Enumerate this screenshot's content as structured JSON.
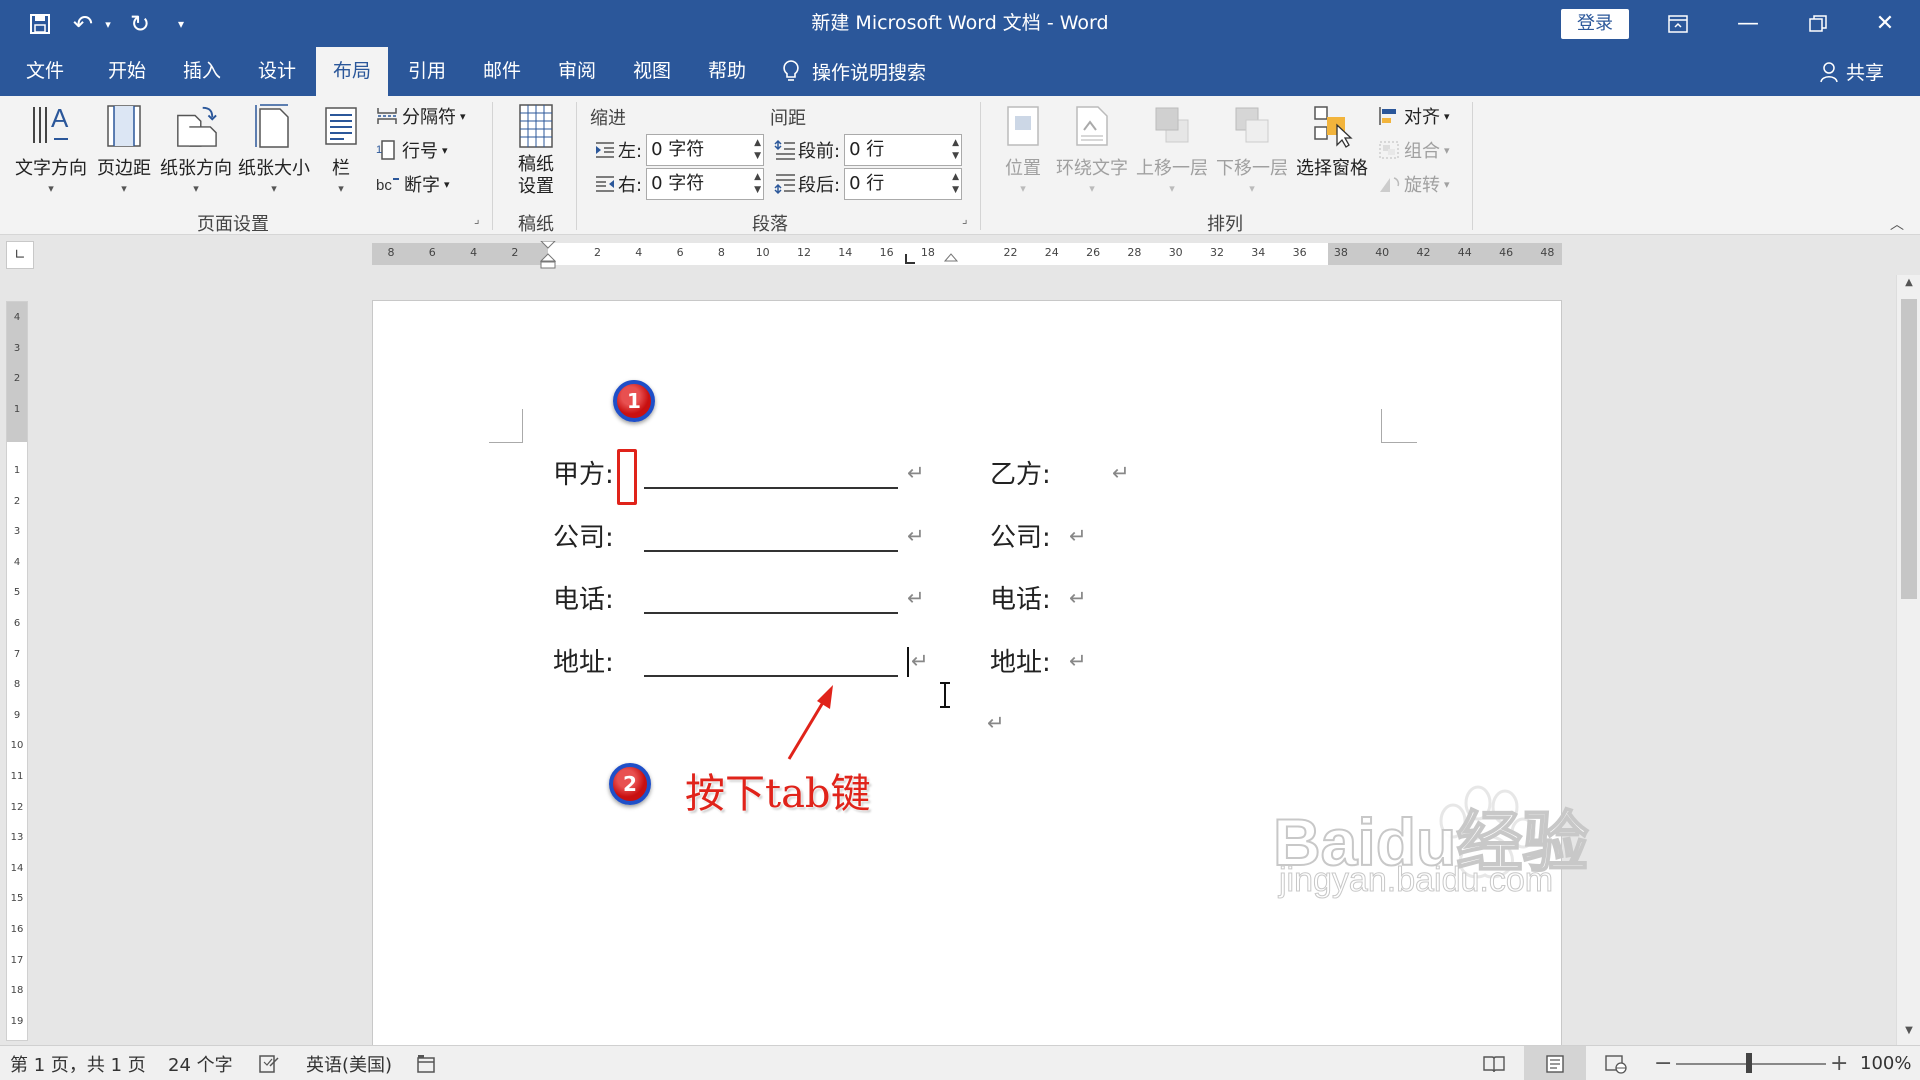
{
  "window": {
    "title": "新建 Microsoft Word 文档 - Word",
    "login_label": "登录"
  },
  "menu": {
    "tabs": [
      {
        "label": "文件"
      },
      {
        "label": "开始"
      },
      {
        "label": "插入"
      },
      {
        "label": "设计"
      },
      {
        "label": "布局"
      },
      {
        "label": "引用"
      },
      {
        "label": "邮件"
      },
      {
        "label": "审阅"
      },
      {
        "label": "视图"
      },
      {
        "label": "帮助"
      }
    ],
    "active_tab": "布局",
    "search_label": "操作说明搜索",
    "share_label": "共享"
  },
  "ribbon": {
    "page_setup": {
      "label": "页面设置",
      "text_direction": "文字方向",
      "margins": "页边距",
      "orientation": "纸张方向",
      "size": "纸张大小",
      "columns": "栏",
      "breaks": "分隔符",
      "line_numbers": "行号",
      "hyphenation": "断字"
    },
    "manuscript": {
      "label": "稿纸",
      "button": "稿纸\n设置"
    },
    "paragraph": {
      "label": "段落",
      "indent_title": "缩进",
      "spacing_title": "间距",
      "left_label": "左:",
      "left_value": "0 字符",
      "right_label": "右:",
      "right_value": "0 字符",
      "before_label": "段前:",
      "before_value": "0 行",
      "after_label": "段后:",
      "after_value": "0 行"
    },
    "arrange": {
      "label": "排列",
      "position": "位置",
      "wrap_text": "环绕文字",
      "bring_forward": "上移一层",
      "send_backward": "下移一层",
      "selection_pane": "选择窗格",
      "align": "对齐",
      "group": "组合",
      "rotate": "旋转"
    }
  },
  "ruler": {
    "labels": [
      "8",
      "6",
      "4",
      "2",
      "",
      "2",
      "4",
      "6",
      "8",
      "10",
      "12",
      "14",
      "16",
      "18",
      "",
      "22",
      "24",
      "26",
      "28",
      "30",
      "32",
      "34",
      "36",
      "38",
      "40",
      "42",
      "44",
      "46",
      "48"
    ],
    "vlabels": [
      "4",
      "3",
      "2",
      "1",
      "",
      "1",
      "2",
      "3",
      "4",
      "5",
      "6",
      "7",
      "8",
      "9",
      "10",
      "11",
      "12",
      "13",
      "14",
      "15",
      "16",
      "17",
      "18",
      "19"
    ]
  },
  "document": {
    "rows": [
      {
        "left_label": "甲方:",
        "right_label": "乙方:"
      },
      {
        "left_label": "公司:",
        "right_label": "公司:"
      },
      {
        "left_label": "电话:",
        "right_label": "电话:"
      },
      {
        "left_label": "地址:",
        "right_label": "地址:"
      }
    ],
    "para_mark": "↵"
  },
  "annotations": {
    "step1": "1",
    "step2": "2",
    "instruction": "按下tab键",
    "accent_red": "#e0231a",
    "badge_blue": "#1f4fc8"
  },
  "watermark": {
    "line1": "Baidu经验",
    "line2": "jingyan.baidu.com"
  },
  "status": {
    "page": "第 1 页，共 1 页",
    "words": "24 个字",
    "language": "英语(美国)",
    "zoom": "100%"
  }
}
